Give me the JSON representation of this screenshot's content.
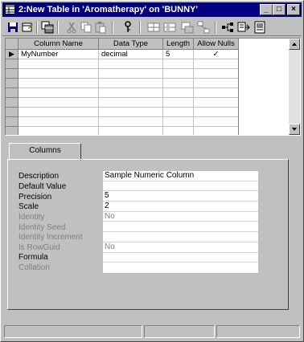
{
  "window": {
    "title": "2:New Table in 'Aromatherapy' on 'BUNNY'",
    "controls": {
      "minimize": "_",
      "maximize": "□",
      "close": "×"
    }
  },
  "toolbar": {
    "icons": [
      "save-icon",
      "table-properties-icon",
      "copy-table-icon",
      "cut-icon",
      "copy-icon",
      "paste-icon",
      "primary-key-icon",
      "insert-column-icon",
      "delete-column-icon",
      "manage-indexes-icon",
      "relationships-icon",
      "manage-constraints-icon",
      "manage-triggers-icon",
      "generate-script-icon"
    ]
  },
  "grid": {
    "columns": [
      "Column Name",
      "Data Type",
      "Length",
      "Allow Nulls"
    ],
    "rows": [
      {
        "name": "MyNumber",
        "type": "decimal",
        "length": "5",
        "allow_nulls": "✓"
      }
    ],
    "current_row_indicator": "▶"
  },
  "tabs": [
    {
      "label": "Columns"
    }
  ],
  "properties": [
    {
      "label": "Description",
      "value": "Sample Numeric Column",
      "disabled": false
    },
    {
      "label": "Default Value",
      "value": "",
      "disabled": false
    },
    {
      "label": "Precision",
      "value": "5",
      "disabled": false
    },
    {
      "label": "Scale",
      "value": "2",
      "disabled": false
    },
    {
      "label": "Identity",
      "value": "No",
      "disabled": true
    },
    {
      "label": "Identity Seed",
      "value": "",
      "disabled": true
    },
    {
      "label": "Identity Increment",
      "value": "",
      "disabled": true
    },
    {
      "label": "Is RowGuid",
      "value": "No",
      "disabled": true
    },
    {
      "label": "Formula",
      "value": "",
      "disabled": false
    },
    {
      "label": "Collation",
      "value": "",
      "disabled": true
    }
  ]
}
